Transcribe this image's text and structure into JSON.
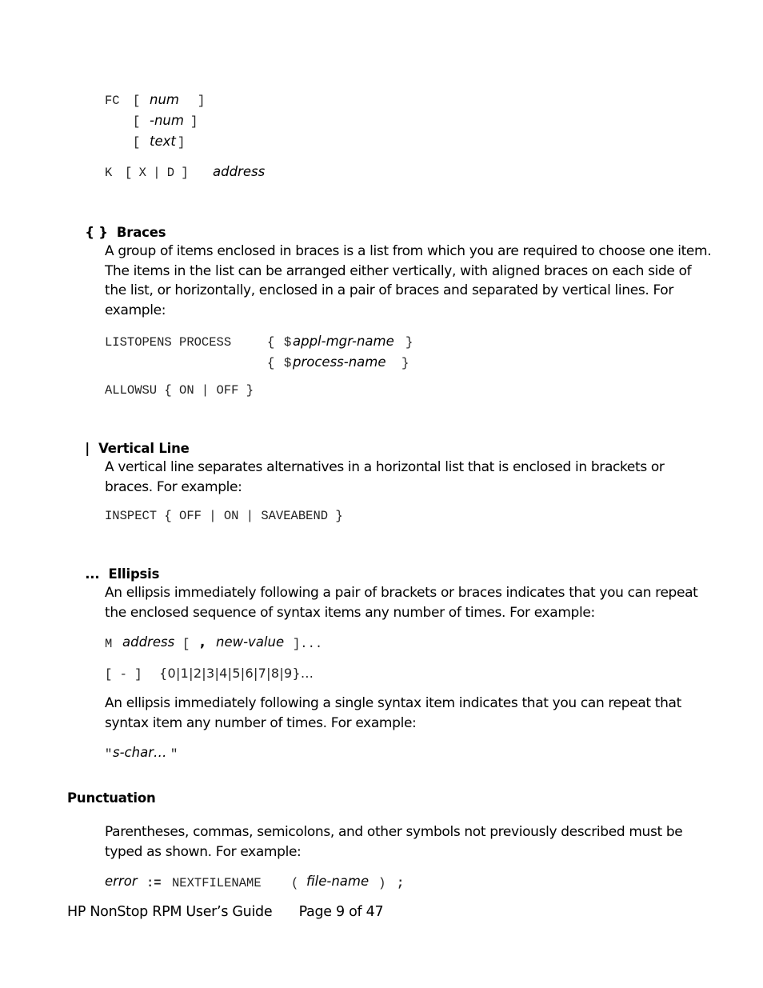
{
  "top_examples": {
    "fc": {
      "keyword": "FC",
      "lines": [
        {
          "open": "[",
          "arg": "num",
          "close": "]"
        },
        {
          "open": "[",
          "arg": "-num",
          "close": "]"
        },
        {
          "open": "[",
          "arg": "text",
          "close": "]"
        }
      ]
    },
    "k": {
      "keyword": "K",
      "bracket_expr": "[ X | D ]",
      "arg": "address"
    }
  },
  "sections": {
    "braces": {
      "symbol": "{ }",
      "title": "Braces",
      "body": "A group of items enclosed in braces is a list from which you are required to choose one item. The items in the list can be arranged either vertically, with aligned braces on each side of the list, or horizontally, enclosed in a pair of braces and separated by vertical lines. For example:",
      "example1": {
        "prefix": "LISTOPENS PROCESS",
        "lines": [
          {
            "open": "{",
            "dollar": "$",
            "arg": "appl-mgr-name",
            "close": "}"
          },
          {
            "open": "{",
            "dollar": "$",
            "arg": "process-name",
            "close": "}"
          }
        ]
      },
      "example2": "ALLOWSU { ON | OFF }"
    },
    "vertical_line": {
      "symbol": "|",
      "title": "Vertical Line",
      "body": "A vertical line separates alternatives in a horizontal list that is enclosed in brackets or braces. For example:",
      "example": "INSPECT { OFF | ON | SAVEABEND }"
    },
    "ellipsis": {
      "symbol": "...",
      "title": "Ellipsis",
      "body1": "An ellipsis immediately following a pair of brackets or braces indicates that you can repeat the enclosed sequence of syntax items any number of times. For example:",
      "example1": {
        "keyword": "M",
        "arg1": "address",
        "open": "[",
        "comma": ",",
        "arg2": "new-value",
        "close": "]..."
      },
      "example2": {
        "prefix": "[ - ]",
        "set": "{0|1|2|3|4|5|6|7|8|9}..."
      },
      "body2": "An ellipsis immediately following a single syntax item indicates that you can repeat that syntax item any number of times. For example:",
      "example3": {
        "quote_open": "\"",
        "arg": "s-char…",
        "quote_close": "\""
      }
    },
    "punctuation": {
      "title": "Punctuation",
      "body": "Parentheses, commas, semicolons, and other symbols not previously described must be typed as shown. For example:",
      "example": {
        "arg1": "error",
        "op": ":=",
        "keyword": "NEXTFILENAME",
        "open": "(",
        "arg2": "file-name",
        "close": ")",
        "semi": ";"
      }
    }
  },
  "footer": {
    "doc_title": "HP NonStop RPM User’s Guide",
    "page_label": "Page 9 of 47"
  }
}
